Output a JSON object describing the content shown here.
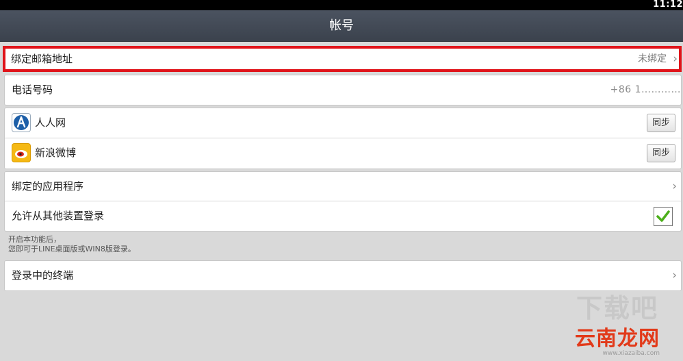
{
  "status_bar": {
    "clock": "11:12"
  },
  "header": {
    "title": "帐号"
  },
  "email_row": {
    "label": "绑定邮箱地址",
    "value": "未绑定"
  },
  "phone_row": {
    "label": "电话号码",
    "value": "+86 1…………"
  },
  "services": [
    {
      "label": "人人网",
      "button": "同步"
    },
    {
      "label": "新浪微博",
      "button": "同步"
    }
  ],
  "apps_row": {
    "label": "绑定的应用程序"
  },
  "allow_login": {
    "label": "允许从其他装置登录",
    "checked": true
  },
  "note": {
    "line1": "开启本功能后，",
    "line2": "您即可于LINE桌面版或WIN8版登录。"
  },
  "terminals_row": {
    "label": "登录中的终端"
  },
  "watermark": {
    "main": "云南龙网",
    "sub": "www.xiazaiba.com",
    "top": "下载吧"
  },
  "colors": {
    "highlight": "#e0141a",
    "check": "#4caf1a",
    "title_bar": "#444b56"
  }
}
